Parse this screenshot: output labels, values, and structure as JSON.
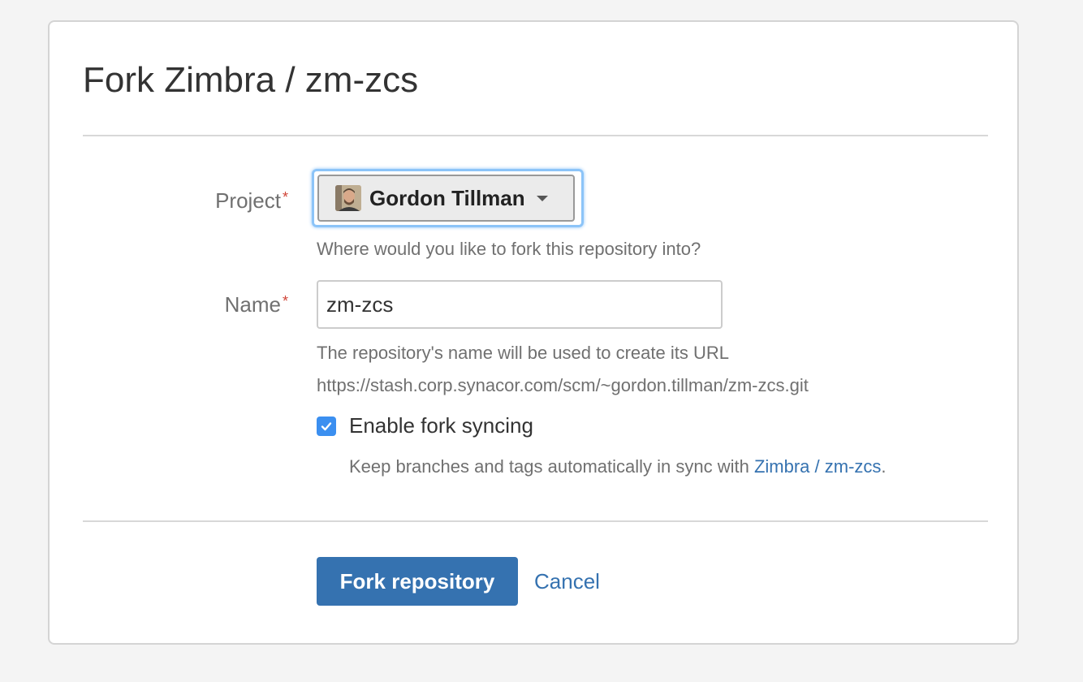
{
  "dialog": {
    "title": "Fork Zimbra / zm-zcs"
  },
  "form": {
    "project": {
      "label": "Project",
      "required_mark": "*",
      "selected": "Gordon Tillman",
      "avatar_icon": "user-avatar",
      "help": "Where would you like to fork this repository into?"
    },
    "name": {
      "label": "Name",
      "required_mark": "*",
      "value": "zm-zcs",
      "help_line1": "The repository's name will be used to create its URL",
      "help_line2": "https://stash.corp.synacor.com/scm/~gordon.tillman/zm-zcs.git"
    },
    "sync": {
      "checked": true,
      "label": "Enable fork syncing",
      "help_prefix": "Keep branches and tags automatically in sync with ",
      "help_link": "Zimbra / zm-zcs",
      "help_suffix": "."
    }
  },
  "actions": {
    "submit": "Fork repository",
    "cancel": "Cancel"
  },
  "colors": {
    "primary": "#3572b0",
    "required": "#d04437",
    "focus": "#8cc4f8",
    "checkbox": "#3b8ff0"
  }
}
